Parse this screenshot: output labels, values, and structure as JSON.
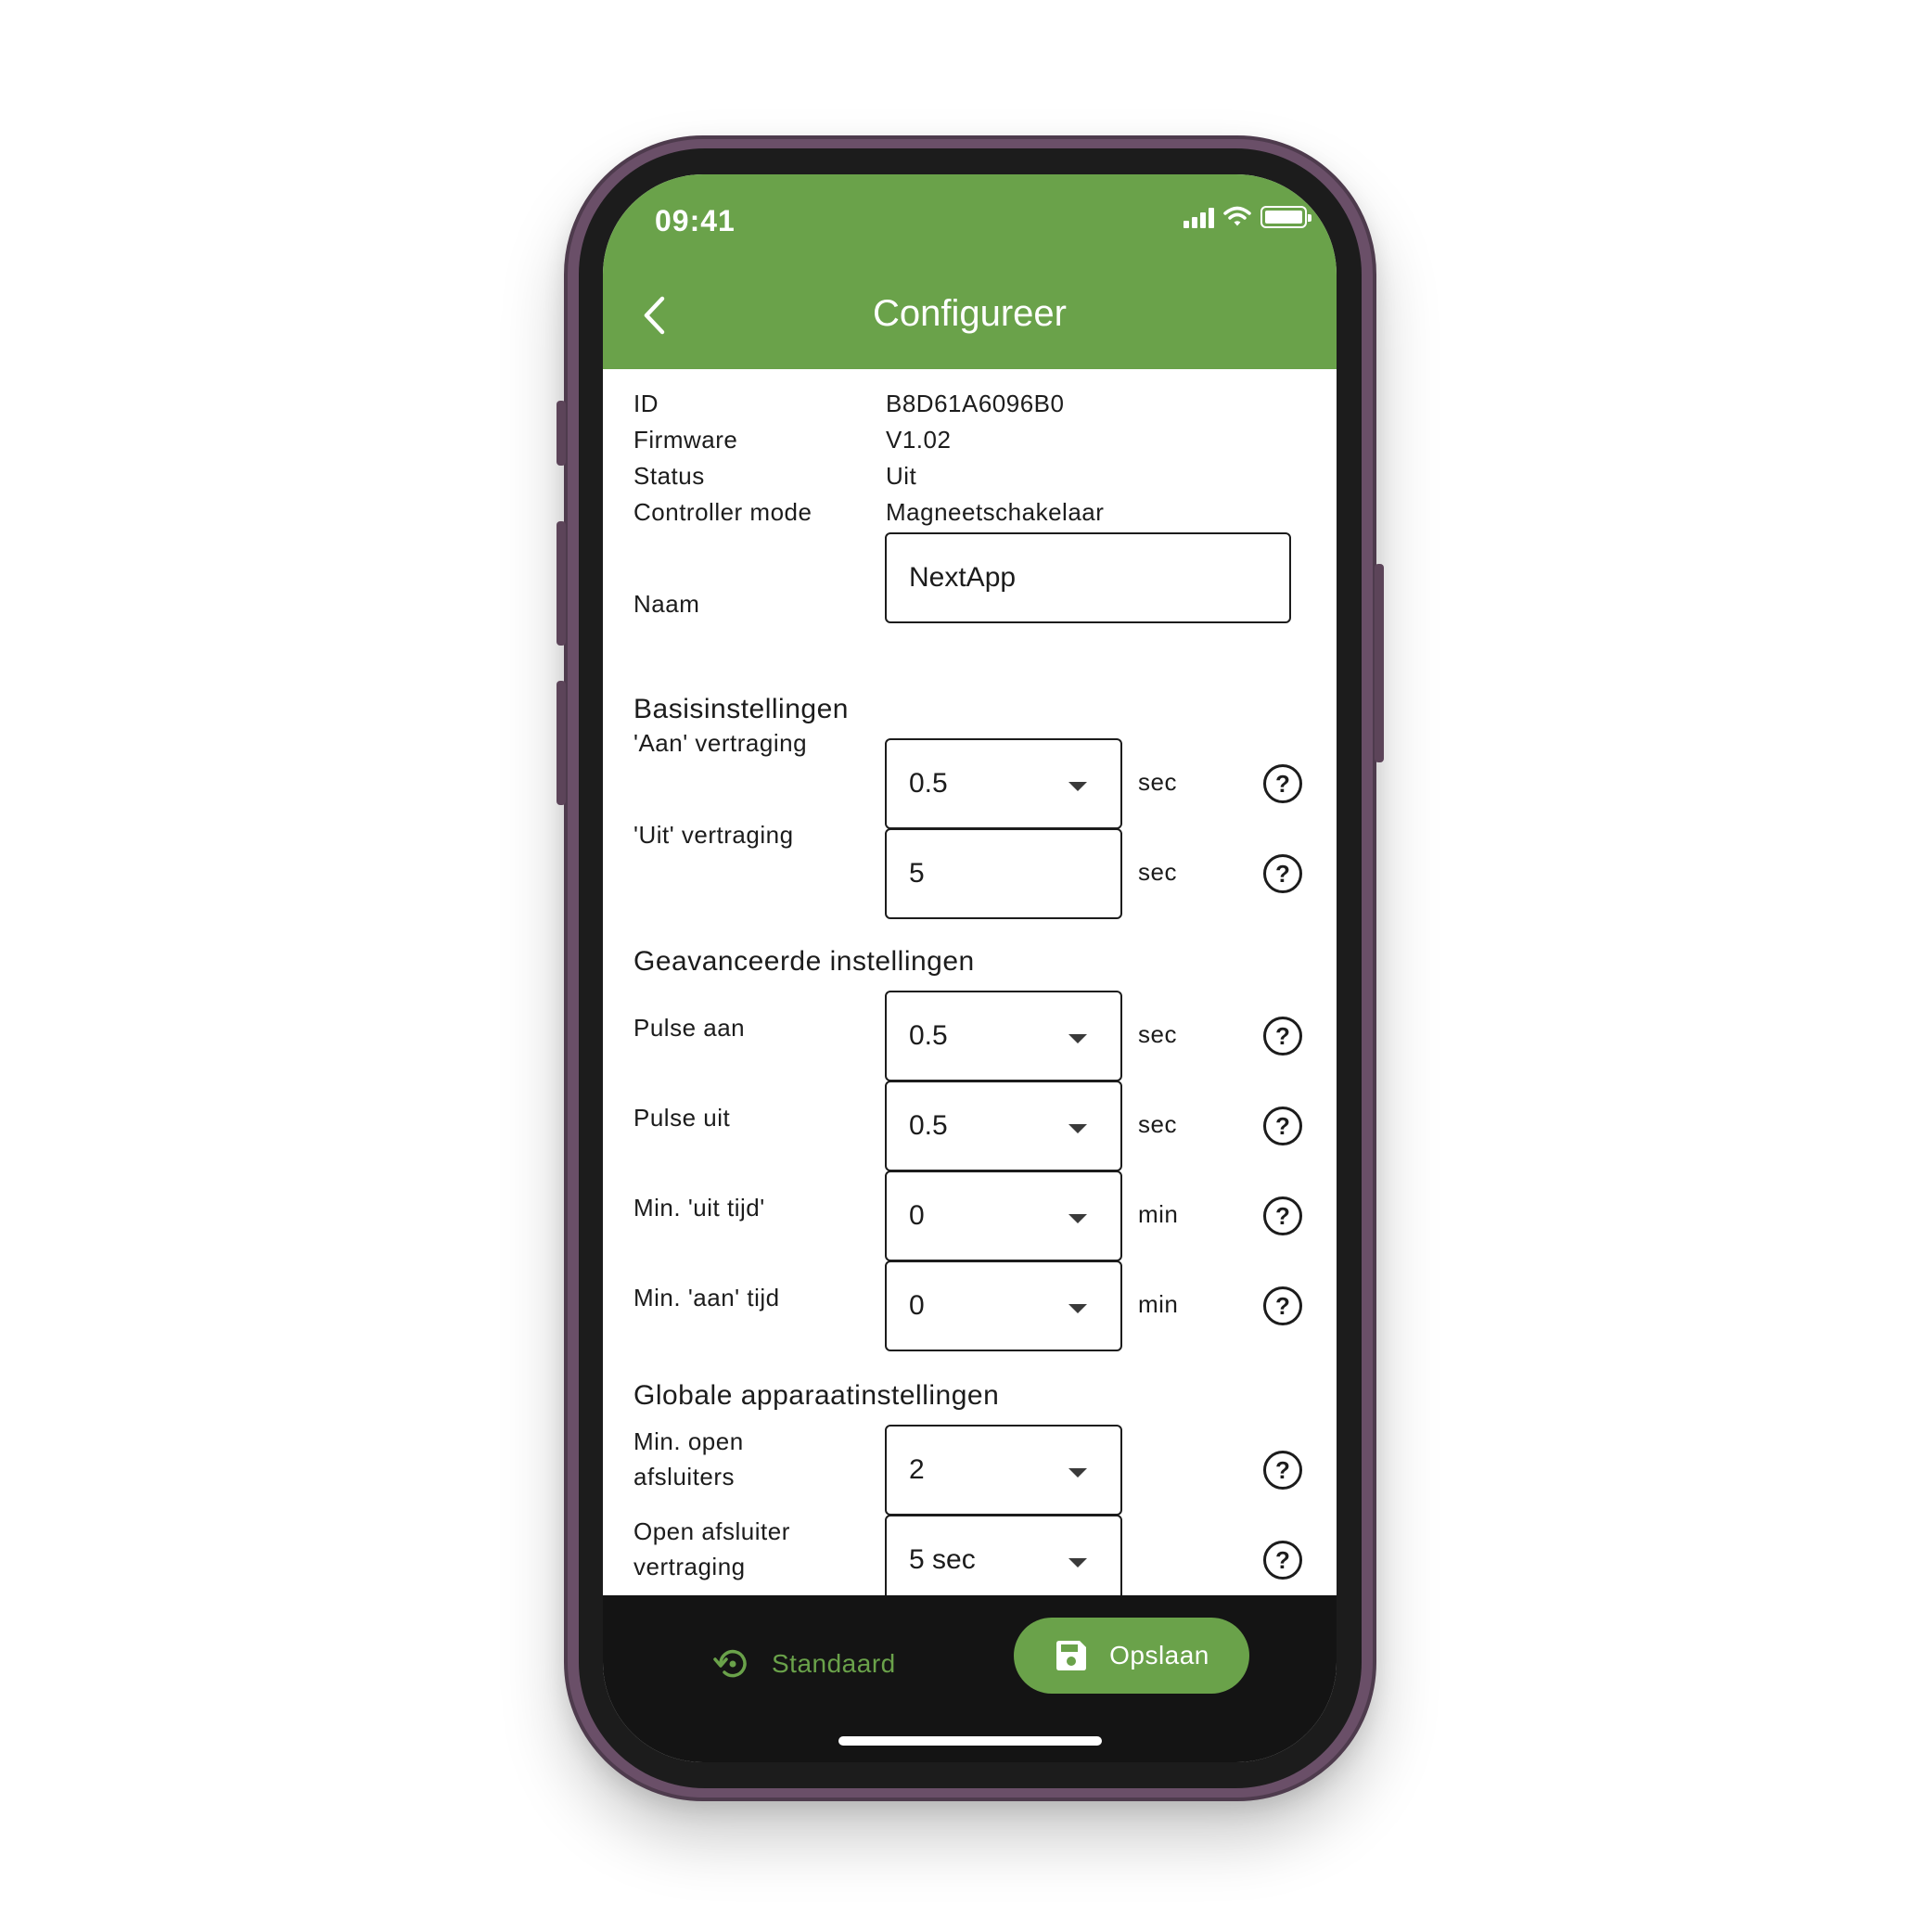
{
  "status_bar": {
    "time": "09:41"
  },
  "header": {
    "title": "Configureer"
  },
  "info": [
    {
      "label": "ID",
      "value": "B8D61A6096B0"
    },
    {
      "label": "Firmware",
      "value": "V1.02"
    },
    {
      "label": "Status",
      "value": "Uit"
    },
    {
      "label": "Controller mode",
      "value": "Magneetschakelaar"
    }
  ],
  "name_field": {
    "label": "Naam",
    "value": "NextApp"
  },
  "sections": {
    "basic": "Basisinstellingen",
    "advanced": "Geavanceerde instellingen",
    "global": "Globale apparaatinstellingen"
  },
  "settings": {
    "aan_vertraging": {
      "label": "'Aan' vertraging",
      "value": "0.5",
      "unit": "sec"
    },
    "uit_vertraging": {
      "label": "'Uit' vertraging",
      "value": "5",
      "unit": "sec"
    },
    "pulse_aan": {
      "label": "Pulse aan",
      "value": "0.5",
      "unit": "sec"
    },
    "pulse_uit": {
      "label": "Pulse uit",
      "value": "0.5",
      "unit": "sec"
    },
    "min_uit_tijd": {
      "label": "Min. 'uit tijd'",
      "value": "0",
      "unit": "min"
    },
    "min_aan_tijd": {
      "label": "Min. 'aan' tijd",
      "value": "0",
      "unit": "min"
    },
    "min_open_afsluiters": {
      "label_line1": "Min. open",
      "label_line2": "afsluiters",
      "value": "2"
    },
    "open_afsluiter_vertraging": {
      "label_line1": "Open afsluiter",
      "label_line2": "vertraging",
      "value": "5 sec"
    }
  },
  "help_symbol": "?",
  "bottom_bar": {
    "standaard_label": "Standaard",
    "opslaan_label": "Opslaan"
  },
  "colors": {
    "brand_green": "#6aa24a",
    "bottom_bar": "#141414",
    "frame": "#6a4f68"
  },
  "icons": [
    "back-chevron-icon",
    "signal-icon",
    "wifi-icon",
    "battery-icon",
    "dropdown-caret-icon",
    "help-icon",
    "restore-icon",
    "save-floppy-icon"
  ]
}
